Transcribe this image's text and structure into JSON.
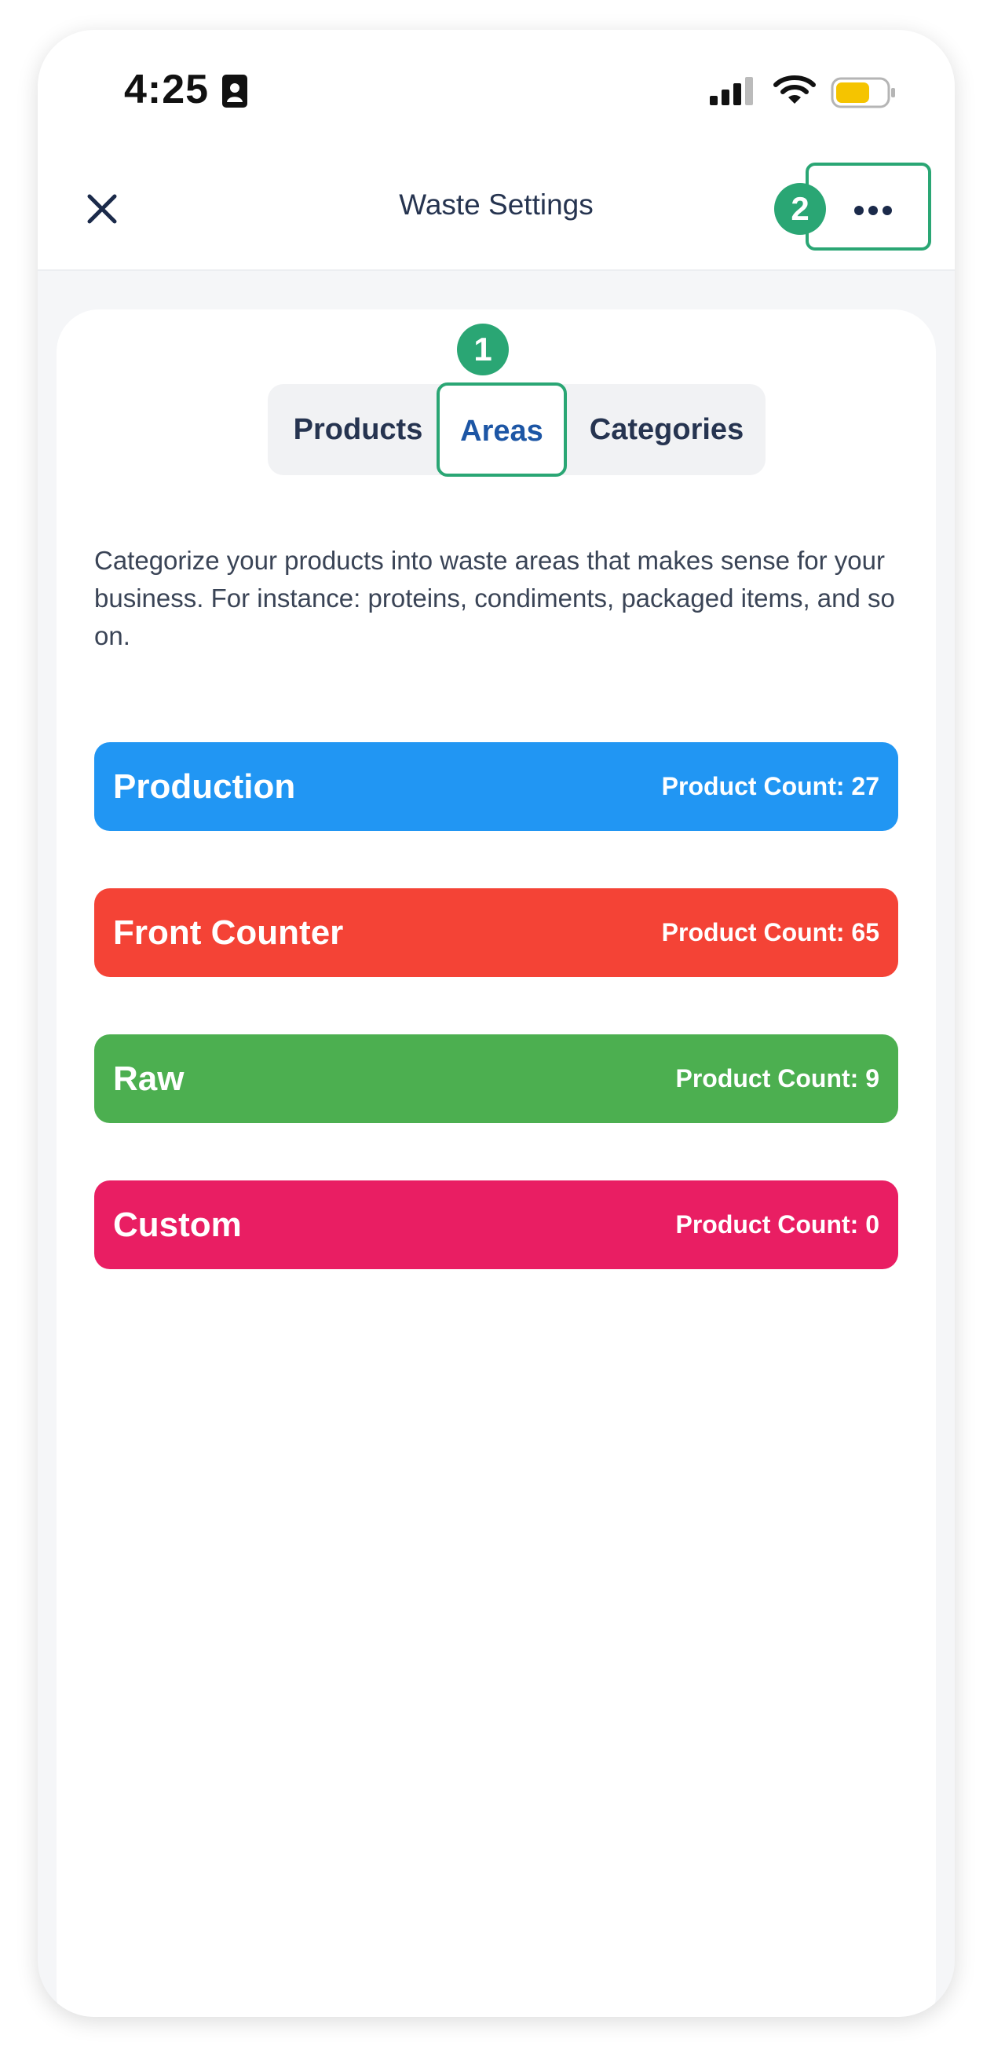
{
  "status_bar": {
    "time": "4:25",
    "icons": [
      "contact-card-icon",
      "cellular-signal-icon",
      "wifi-icon",
      "battery-icon"
    ],
    "battery_color": "#f5c400"
  },
  "header": {
    "title": "Waste Settings",
    "close_icon": "close-icon",
    "more_icon": "more-horizontal-icon"
  },
  "markers": {
    "areas_tab": "1",
    "more_button": "2",
    "color": "#2aa674"
  },
  "tabs": {
    "items": [
      {
        "label": "Products",
        "selected": false
      },
      {
        "label": "Areas",
        "selected": true
      },
      {
        "label": "Categories",
        "selected": false
      }
    ]
  },
  "description": "Categorize your products into waste areas that makes sense for your business. For instance: proteins, condiments, packaged items, and so on.",
  "areas": [
    {
      "name": "Production",
      "count_label": "Product Count: 27",
      "color": "#2196f3"
    },
    {
      "name": "Front Counter",
      "count_label": "Product Count: 65",
      "color": "#f44336"
    },
    {
      "name": "Raw",
      "count_label": "Product Count: 9",
      "color": "#4caf50"
    },
    {
      "name": "Custom",
      "count_label": "Product Count: 0",
      "color": "#e91e63"
    }
  ]
}
